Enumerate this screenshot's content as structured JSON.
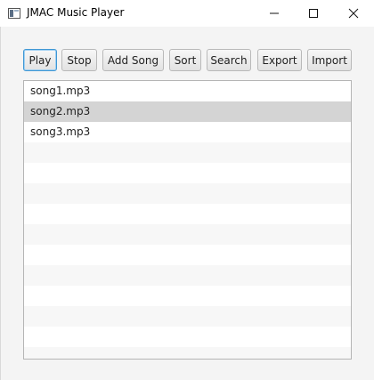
{
  "window": {
    "title": "JMAC Music Player"
  },
  "toolbar": {
    "buttons": [
      {
        "label": "Play",
        "focused": true
      },
      {
        "label": "Stop"
      },
      {
        "label": "Add Song"
      },
      {
        "label": "Sort"
      },
      {
        "label": "Search"
      },
      {
        "label": "Export"
      },
      {
        "label": "Import"
      }
    ]
  },
  "song_list": {
    "items": [
      "song1.mp3",
      "song2.mp3",
      "song3.mp3"
    ],
    "selected_item": "song2.mp3"
  },
  "colors": {
    "selection": "#d4d4d4",
    "focus_border": "#3f97d4"
  }
}
